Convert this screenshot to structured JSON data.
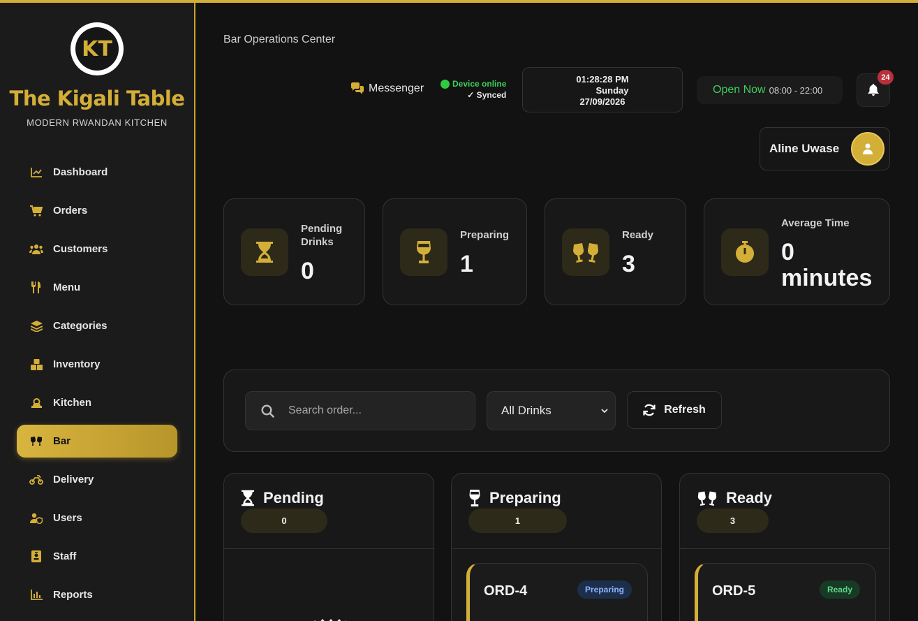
{
  "brand": {
    "logo_text": "KT",
    "name": "The Kigali Table",
    "tagline": "MODERN RWANDAN KITCHEN"
  },
  "nav": [
    {
      "label": "Dashboard",
      "icon": "chart-line-icon"
    },
    {
      "label": "Orders",
      "icon": "cart-icon"
    },
    {
      "label": "Customers",
      "icon": "users-icon"
    },
    {
      "label": "Menu",
      "icon": "utensils-icon"
    },
    {
      "label": "Categories",
      "icon": "layers-icon"
    },
    {
      "label": "Inventory",
      "icon": "boxes-icon"
    },
    {
      "label": "Kitchen",
      "icon": "chef-icon"
    },
    {
      "label": "Bar",
      "icon": "cheers-icon",
      "active": true
    },
    {
      "label": "Delivery",
      "icon": "motorcycle-icon"
    },
    {
      "label": "Users",
      "icon": "user-shield-icon"
    },
    {
      "label": "Staff",
      "icon": "id-badge-icon"
    },
    {
      "label": "Reports",
      "icon": "bar-chart-icon"
    }
  ],
  "header": {
    "breadcrumb": "Bar Operations Center",
    "messenger": "Messenger",
    "device_status": "Device online",
    "sync_status": "✓ Synced",
    "time": "01:28:28 PM",
    "day": "Sunday",
    "date": "27/09/2026",
    "open_status": "Open Now",
    "hours": "08:00 - 22:00",
    "notifications": "24",
    "user_name": "Aline Uwase"
  },
  "stats": [
    {
      "label": "Pending Drinks",
      "value": "0",
      "icon": "hourglass-icon"
    },
    {
      "label": "Preparing",
      "value": "1",
      "icon": "wine-glass-icon"
    },
    {
      "label": "Ready",
      "value": "3",
      "icon": "cheers-icon"
    },
    {
      "label": "Average Time",
      "value": "0 minutes",
      "icon": "stopwatch-icon"
    }
  ],
  "filters": {
    "search_placeholder": "Search order...",
    "drink_filter": "All Drinks",
    "refresh_label": "Refresh"
  },
  "columns": [
    {
      "title": "Pending",
      "count": "0",
      "icon": "hourglass-icon"
    },
    {
      "title": "Preparing",
      "count": "1",
      "icon": "wine-glass-icon",
      "order": {
        "id": "ORD-4",
        "status": "Preparing"
      }
    },
    {
      "title": "Ready",
      "count": "3",
      "icon": "cheers-icon",
      "order": {
        "id": "ORD-5",
        "status": "Ready"
      }
    }
  ],
  "colors": {
    "accent": "#d4af37",
    "background": "#121212",
    "online": "#3fcf5b",
    "badge": "#b9303a"
  }
}
